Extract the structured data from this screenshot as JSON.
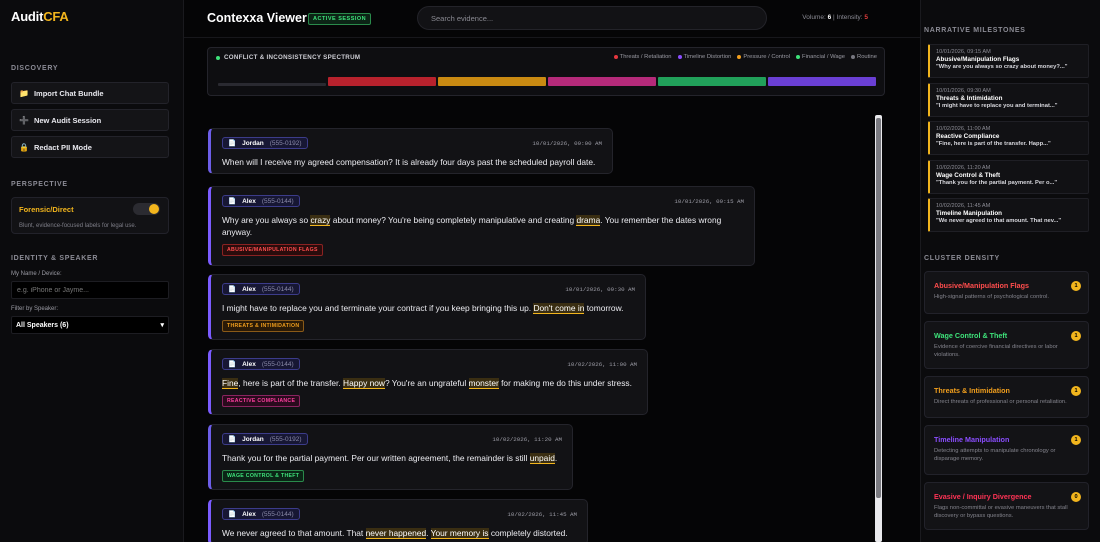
{
  "brand": {
    "name_a": "Audit",
    "name_b": "CFA"
  },
  "discovery": {
    "heading": "DISCOVERY",
    "buttons": [
      {
        "icon": "📁",
        "label": "Import Chat Bundle"
      },
      {
        "icon": "➕",
        "label": "New Audit Session"
      },
      {
        "icon": "🔒",
        "label": "Redact PII Mode"
      }
    ]
  },
  "perspective": {
    "heading": "PERSPECTIVE",
    "mode": "Forensic/Direct",
    "subtitle": "Blunt, evidence-focused labels for legal use.",
    "enabled": true
  },
  "identity": {
    "heading": "IDENTITY & SPEAKER",
    "name_label": "My Name / Device:",
    "name_placeholder": "e.g. iPhone or Jayme...",
    "filter_label": "Filter by Speaker:",
    "filter_value": "All Speakers (6)"
  },
  "header": {
    "title": "Contexxa Viewer",
    "session_badge": "ACTIVE SESSION",
    "search_placeholder": "Search evidence...",
    "volume_label": "Volume:",
    "volume_value": "6",
    "intensity_label": "| Intensity:",
    "intensity_value": "5"
  },
  "spectrum": {
    "title": "CONFLICT & INCONSISTENCY SPECTRUM",
    "legend": [
      {
        "label": "Threats / Retaliation",
        "color": "#e5373f"
      },
      {
        "label": "Timeline Distortion",
        "color": "#8a4dff"
      },
      {
        "label": "Pressure / Control",
        "color": "#f29f1d"
      },
      {
        "label": "Financial / Wage",
        "color": "#3ee27a"
      },
      {
        "label": "Routine",
        "color": "#777780"
      }
    ],
    "segments": [
      {
        "color": "#2a2a31"
      },
      {
        "color": "#b8222d"
      },
      {
        "color": "#c98a12"
      },
      {
        "color": "#b52a7a"
      },
      {
        "color": "#21a05a"
      },
      {
        "color": "#6a3fd4"
      }
    ]
  },
  "messages": [
    {
      "speaker": "Jordan",
      "phone": "(555-0192)",
      "timestamp": "10/01/2026, 09:00 AM",
      "parts": [
        {
          "t": "When will I receive my agreed compensation? It is already four days past the scheduled payroll date."
        }
      ],
      "tag": null
    },
    {
      "speaker": "Alex",
      "phone": "(555-0144)",
      "timestamp": "10/01/2026, 09:15 AM",
      "parts": [
        {
          "t": "Why are you always so "
        },
        {
          "t": "crazy",
          "hl": true
        },
        {
          "t": " about money? You're being completely manipulative and creating "
        },
        {
          "t": "drama",
          "hl": true
        },
        {
          "t": ". You remember the dates wrong anyway."
        }
      ],
      "tag": {
        "label": "ABUSIVE/MANIPULATION FLAGS",
        "tone": "red"
      }
    },
    {
      "speaker": "Alex",
      "phone": "(555-0144)",
      "timestamp": "10/01/2026, 09:30 AM",
      "parts": [
        {
          "t": "I might have to replace you and terminate your contract if you keep bringing this up. "
        },
        {
          "t": "Don't come in",
          "hl": true
        },
        {
          "t": " tomorrow."
        }
      ],
      "tag": {
        "label": "THREATS & INTIMIDATION",
        "tone": "orange"
      }
    },
    {
      "speaker": "Alex",
      "phone": "(555-0144)",
      "timestamp": "10/02/2026, 11:00 AM",
      "parts": [
        {
          "t": "Fine",
          "hl": true
        },
        {
          "t": ", here is part of the transfer. "
        },
        {
          "t": "Happy now",
          "hl": true
        },
        {
          "t": "? You're an ungrateful "
        },
        {
          "t": "monster",
          "hl": true
        },
        {
          "t": " for making me do this under stress."
        }
      ],
      "tag": {
        "label": "REACTIVE COMPLIANCE",
        "tone": "pink"
      }
    },
    {
      "speaker": "Jordan",
      "phone": "(555-0192)",
      "timestamp": "10/02/2026, 11:20 AM",
      "parts": [
        {
          "t": "Thank you for the partial payment. Per our written agreement, the remainder is still "
        },
        {
          "t": "unpaid",
          "hl": true
        },
        {
          "t": "."
        }
      ],
      "tag": {
        "label": "WAGE CONTROL & THEFT",
        "tone": "green"
      }
    },
    {
      "speaker": "Alex",
      "phone": "(555-0144)",
      "timestamp": "10/02/2026, 11:45 AM",
      "parts": [
        {
          "t": "We never agreed to that amount. That "
        },
        {
          "t": "never happened",
          "hl": true
        },
        {
          "t": ". "
        },
        {
          "t": "Your memory is",
          "hl": true
        },
        {
          "t": " completely distorted."
        }
      ],
      "tag": null
    }
  ],
  "milestones": {
    "heading": "NARRATIVE MILESTONES",
    "items": [
      {
        "date": "10/01/2026, 09:15 AM",
        "name": "Abusive/Manipulation Flags",
        "quote": "\"Why are you always so crazy about money?...\""
      },
      {
        "date": "10/01/2026, 09:30 AM",
        "name": "Threats & Intimidation",
        "quote": "\"I might have to replace you and terminat...\""
      },
      {
        "date": "10/02/2026, 11:00 AM",
        "name": "Reactive Compliance",
        "quote": "\"Fine, here is part of the transfer. Happ...\""
      },
      {
        "date": "10/02/2026, 11:20 AM",
        "name": "Wage Control & Theft",
        "quote": "\"Thank you for the partial payment. Per o...\""
      },
      {
        "date": "10/02/2026, 11:45 AM",
        "name": "Timeline Manipulation",
        "quote": "\"We never agreed to that amount. That nev...\""
      }
    ]
  },
  "clusters": {
    "heading": "CLUSTER DENSITY",
    "items": [
      {
        "name": "Abusive/Manipulation Flags",
        "desc": "High-signal patterns of psychological control.",
        "count": "1",
        "color": "#ff4d4d"
      },
      {
        "name": "Wage Control & Theft",
        "desc": "Evidence of coercive financial directives or labor violations.",
        "count": "1",
        "color": "#3ee27a"
      },
      {
        "name": "Threats & Intimidation",
        "desc": "Direct threats of professional or personal retaliation.",
        "count": "1",
        "color": "#f29f1d"
      },
      {
        "name": "Timeline Manipulation",
        "desc": "Detecting attempts to manipulate chronology or disparage memory.",
        "count": "1",
        "color": "#8a4dff"
      },
      {
        "name": "Evasive / Inquiry Divergence",
        "desc": "Flags non-committal or evasive maneuvers that stall discovery or bypass questions.",
        "count": "0",
        "color": "#ff3355"
      }
    ]
  }
}
